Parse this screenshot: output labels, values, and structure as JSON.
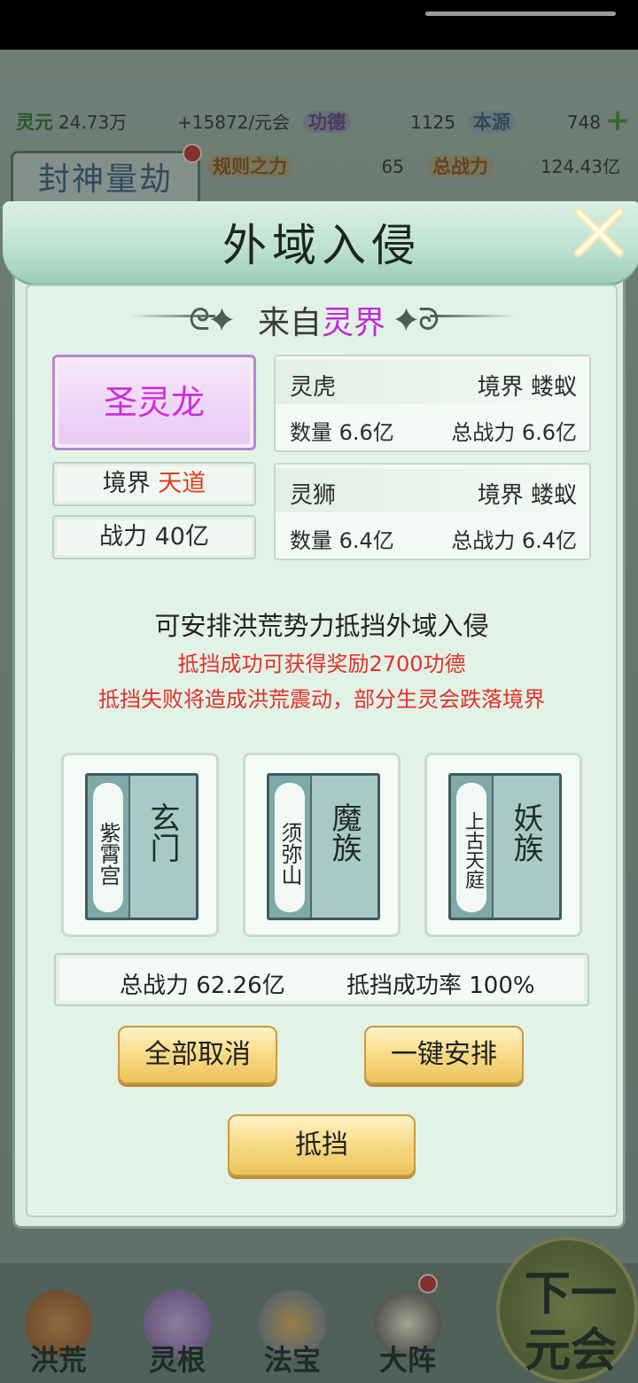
{
  "background": {
    "resources": {
      "lingyuan_label": "灵元",
      "lingyuan_value": "24.73万",
      "lingyuan_rate": "+15872/元会",
      "gongde_label": "功德",
      "gongde_value": "1125",
      "benyuan_label": "本源",
      "benyuan_value": "748",
      "guize_label": "规则之力",
      "guize_value": "65",
      "zongzhanli_label": "总战力",
      "zongzhanli_value": "124.43亿"
    },
    "event_title": "封神量劫",
    "nav": [
      "洪荒",
      "灵根",
      "法宝",
      "大阵"
    ],
    "next_era": [
      "下一",
      "元会"
    ]
  },
  "modal": {
    "title": "外域入侵",
    "origin_prefix": "来自",
    "origin_realm": "灵界",
    "boss": {
      "name": "圣灵龙",
      "realm_label": "境界",
      "realm_value": "天道",
      "power_text": "战力 40亿"
    },
    "units": [
      {
        "name": "灵虎",
        "realm": "境界 蝼蚁",
        "count": "数量 6.6亿",
        "power": "总战力 6.6亿"
      },
      {
        "name": "灵狮",
        "realm": "境界 蝼蚁",
        "count": "数量 6.4亿",
        "power": "总战力 6.4亿"
      }
    ],
    "message_main": "可安排洪荒势力抵挡外域入侵",
    "message_reward": "抵挡成功可获得奖励2700功德",
    "message_fail": "抵挡失败将造成洪荒震动，部分生灵会跌落境界",
    "forces": [
      {
        "sect": "紫霄宫",
        "faction": "玄门"
      },
      {
        "sect": "须弥山",
        "faction": "魔族"
      },
      {
        "sect": "上古天庭",
        "faction": "妖族"
      }
    ],
    "total_power": "总战力 62.26亿",
    "success_rate": "抵挡成功率 100%",
    "buttons": {
      "cancel_all": "全部取消",
      "auto_arrange": "一键安排",
      "defend": "抵挡"
    }
  },
  "colors": {
    "realm_magenta": "#c22bd3",
    "warning_red": "#e0322a",
    "gold_button": "#f8dc8a"
  }
}
